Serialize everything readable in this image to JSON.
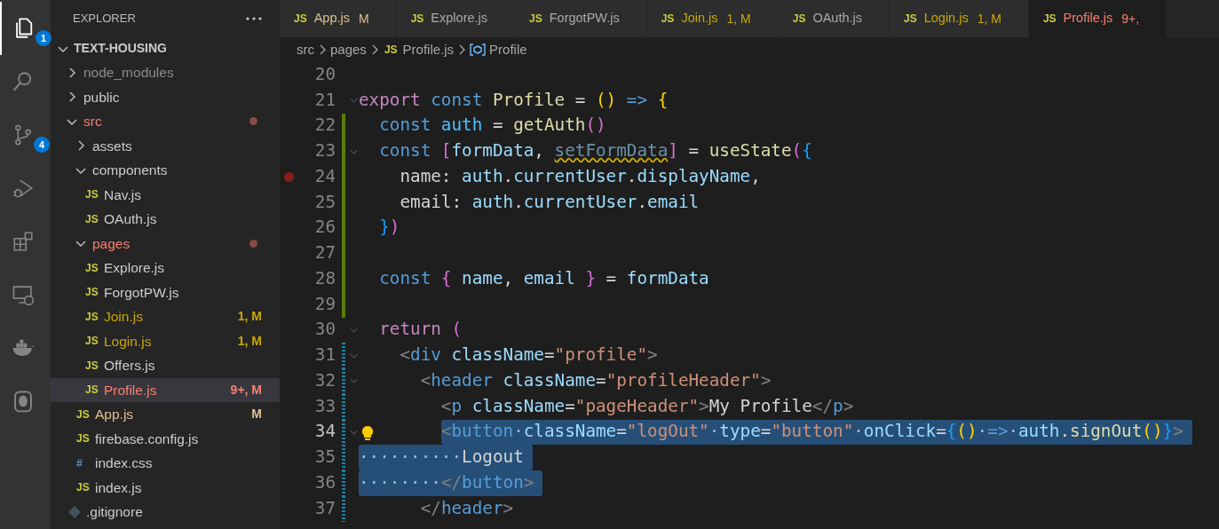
{
  "activity_bar": [
    {
      "kind": "files",
      "selected": true,
      "badge": "1"
    },
    {
      "kind": "search",
      "selected": false
    },
    {
      "kind": "source-control",
      "selected": false,
      "badge": "4"
    },
    {
      "kind": "run-debug",
      "selected": false
    },
    {
      "kind": "extensions",
      "selected": false
    },
    {
      "kind": "remote",
      "selected": false
    },
    {
      "kind": "docker",
      "selected": false
    },
    {
      "kind": "database",
      "selected": false
    }
  ],
  "sidebar": {
    "title": "EXPLORER",
    "root": {
      "label": "TEXT-HOUSING",
      "expanded": true
    },
    "items": [
      {
        "kind": "folder",
        "label": "node_modules",
        "expanded": false,
        "color": "#8c8c8c",
        "dot": false
      },
      {
        "kind": "folder",
        "label": "public",
        "expanded": false,
        "color": "#cccccc",
        "dot": false
      },
      {
        "kind": "folder",
        "label": "src",
        "expanded": true,
        "color": "#f88070",
        "dot": true,
        "children": [
          {
            "kind": "folder",
            "label": "assets",
            "expanded": false,
            "color": "#cccccc",
            "dot": false
          },
          {
            "kind": "folder",
            "label": "components",
            "expanded": true,
            "color": "#cccccc",
            "dot": false,
            "children": [
              {
                "kind": "js",
                "icon_text": "JS",
                "label": "Nav.js",
                "color": "#cccccc",
                "selected": false
              },
              {
                "kind": "js",
                "icon_text": "JS",
                "label": "OAuth.js",
                "color": "#cccccc",
                "selected": false
              }
            ]
          },
          {
            "kind": "folder",
            "label": "pages",
            "expanded": true,
            "color": "#f88070",
            "dot": true,
            "children": [
              {
                "kind": "js",
                "icon_text": "JS",
                "label": "Explore.js",
                "color": "#cccccc",
                "selected": false
              },
              {
                "kind": "js",
                "icon_text": "JS",
                "label": "ForgotPW.js",
                "color": "#cccccc",
                "selected": false
              },
              {
                "kind": "js",
                "icon_text": "JS",
                "label": "Join.js",
                "color": "#cca700",
                "badge": "1, M",
                "selected": false
              },
              {
                "kind": "js",
                "icon_text": "JS",
                "label": "Login.js",
                "color": "#cca700",
                "badge": "1, M",
                "selected": false
              },
              {
                "kind": "js",
                "icon_text": "JS",
                "label": "Offers.js",
                "color": "#cccccc",
                "selected": false
              },
              {
                "kind": "js",
                "icon_text": "JS",
                "label": "Profile.js",
                "color": "#f88070",
                "badge": "9+, M",
                "selected": true
              }
            ]
          },
          {
            "kind": "js",
            "icon_text": "JS",
            "label": "App.js",
            "color": "#e2c08d",
            "badge": "M",
            "selected": false
          },
          {
            "kind": "js",
            "icon_text": "JS",
            "label": "firebase.config.js",
            "color": "#cccccc",
            "selected": false
          },
          {
            "kind": "css",
            "icon_text": "#",
            "label": "index.css",
            "color": "#cccccc",
            "selected": false
          },
          {
            "kind": "js",
            "icon_text": "JS",
            "label": "index.js",
            "color": "#cccccc",
            "selected": false
          }
        ]
      },
      {
        "kind": "git",
        "label": ".gitignore",
        "color": "#cccccc",
        "selected": false
      }
    ]
  },
  "tabs": [
    {
      "icon_text": "JS",
      "label": "App.js",
      "badge": "M",
      "color": "#e2c08d",
      "selected": false
    },
    {
      "icon_text": "JS",
      "label": "Explore.js",
      "color": "#a9a9a9",
      "selected": false
    },
    {
      "icon_text": "JS",
      "label": "ForgotPW.js",
      "color": "#a9a9a9",
      "selected": false
    },
    {
      "icon_text": "JS",
      "label": "Join.js",
      "badge": "1, M",
      "color": "#cca700",
      "selected": false
    },
    {
      "icon_text": "JS",
      "label": "OAuth.js",
      "color": "#a9a9a9",
      "selected": false
    },
    {
      "icon_text": "JS",
      "label": "Login.js",
      "badge": "1, M",
      "color": "#cca700",
      "selected": false
    },
    {
      "icon_text": "JS",
      "label": "Profile.js",
      "badge": "9+,",
      "color": "#f88070",
      "selected": true
    }
  ],
  "breadcrumbs": [
    {
      "kind": "folder",
      "label": "src"
    },
    {
      "kind": "folder",
      "label": "pages"
    },
    {
      "kind": "file",
      "icon_text": "JS",
      "label": "Profile.js"
    },
    {
      "kind": "symbol",
      "label": "Profile"
    }
  ],
  "editor": {
    "lines": [
      {
        "number": "20",
        "added": false,
        "modified": false,
        "fold": false,
        "breakpoint": false,
        "lightbulb": false,
        "current": false,
        "selected": false
      },
      {
        "number": "21",
        "added": false,
        "modified": false,
        "fold": true,
        "breakpoint": false,
        "lightbulb": false,
        "current": false,
        "selected": false,
        "tokens": [
          {
            "kind": "control",
            "text": "export"
          },
          {
            "kind": "keyword",
            "text": " const"
          },
          {
            "kind": "function",
            "text": " Profile"
          },
          {
            "kind": "plain",
            "text": " = "
          },
          {
            "kind": "bracket1",
            "text": "()"
          },
          {
            "kind": "keyword",
            "text": " =>"
          },
          {
            "kind": "bracket1",
            "text": " {"
          }
        ]
      },
      {
        "number": "22",
        "added": true,
        "modified": false,
        "fold": false,
        "breakpoint": false,
        "lightbulb": false,
        "current": false,
        "selected": false,
        "tokens": [
          {
            "kind": "keyword",
            "text": "  const"
          },
          {
            "kind": "constant",
            "text": " auth"
          },
          {
            "kind": "plain",
            "text": " = "
          },
          {
            "kind": "function",
            "text": "getAuth"
          },
          {
            "kind": "bracket2",
            "text": "()"
          }
        ]
      },
      {
        "number": "23",
        "added": true,
        "modified": false,
        "fold": true,
        "breakpoint": false,
        "lightbulb": false,
        "current": false,
        "selected": false,
        "tokens": [
          {
            "kind": "keyword",
            "text": "  const"
          },
          {
            "kind": "bracket2",
            "text": " ["
          },
          {
            "kind": "variable",
            "text": "formData"
          },
          {
            "kind": "plain",
            "text": ", "
          },
          {
            "kind": "unused",
            "text": "setFormData"
          },
          {
            "kind": "bracket2",
            "text": "]"
          },
          {
            "kind": "plain",
            "text": " = "
          },
          {
            "kind": "function",
            "text": "useState"
          },
          {
            "kind": "bracket2",
            "text": "("
          },
          {
            "kind": "bracket3",
            "text": "{"
          }
        ]
      },
      {
        "number": "24",
        "added": true,
        "modified": false,
        "fold": false,
        "breakpoint": true,
        "lightbulb": false,
        "current": false,
        "selected": false,
        "tokens": [
          {
            "kind": "plain",
            "text": "    name: "
          },
          {
            "kind": "variable",
            "text": "auth"
          },
          {
            "kind": "plain",
            "text": "."
          },
          {
            "kind": "variable",
            "text": "currentUser"
          },
          {
            "kind": "plain",
            "text": "."
          },
          {
            "kind": "variable",
            "text": "displayName"
          },
          {
            "kind": "plain",
            "text": ","
          }
        ]
      },
      {
        "number": "25",
        "added": true,
        "modified": false,
        "fold": false,
        "breakpoint": false,
        "lightbulb": false,
        "current": false,
        "selected": false,
        "tokens": [
          {
            "kind": "plain",
            "text": "    email: "
          },
          {
            "kind": "variable",
            "text": "auth"
          },
          {
            "kind": "plain",
            "text": "."
          },
          {
            "kind": "variable",
            "text": "currentUser"
          },
          {
            "kind": "plain",
            "text": "."
          },
          {
            "kind": "variable",
            "text": "email"
          }
        ]
      },
      {
        "number": "26",
        "added": true,
        "modified": false,
        "fold": false,
        "breakpoint": false,
        "lightbulb": false,
        "current": false,
        "selected": false,
        "tokens": [
          {
            "kind": "bracket3",
            "text": "  }"
          },
          {
            "kind": "bracket2",
            "text": ")"
          }
        ]
      },
      {
        "number": "27",
        "added": true,
        "modified": false,
        "fold": false,
        "breakpoint": false,
        "lightbulb": false,
        "current": false,
        "selected": false
      },
      {
        "number": "28",
        "added": true,
        "modified": false,
        "fold": false,
        "breakpoint": false,
        "lightbulb": false,
        "current": false,
        "selected": false,
        "tokens": [
          {
            "kind": "keyword",
            "text": "  const"
          },
          {
            "kind": "bracket2",
            "text": " {"
          },
          {
            "kind": "variable",
            "text": " name"
          },
          {
            "kind": "plain",
            "text": ", "
          },
          {
            "kind": "variable",
            "text": "email"
          },
          {
            "kind": "bracket2",
            "text": " }"
          },
          {
            "kind": "plain",
            "text": " = "
          },
          {
            "kind": "variable",
            "text": "formData"
          }
        ]
      },
      {
        "number": "29",
        "added": true,
        "modified": false,
        "fold": false,
        "breakpoint": false,
        "lightbulb": false,
        "current": false,
        "selected": false
      },
      {
        "number": "30",
        "added": false,
        "modified": false,
        "fold": true,
        "breakpoint": false,
        "lightbulb": false,
        "current": false,
        "selected": false,
        "tokens": [
          {
            "kind": "control",
            "text": "  return"
          },
          {
            "kind": "bracket2",
            "text": " ("
          }
        ]
      },
      {
        "number": "31",
        "added": false,
        "modified": true,
        "fold": true,
        "breakpoint": false,
        "lightbulb": false,
        "current": false,
        "selected": false,
        "tokens": [
          {
            "kind": "tag-bracket",
            "text": "    <"
          },
          {
            "kind": "tag",
            "text": "div"
          },
          {
            "kind": "attribute",
            "text": " className"
          },
          {
            "kind": "plain",
            "text": "="
          },
          {
            "kind": "string",
            "text": "\"profile\""
          },
          {
            "kind": "tag-bracket",
            "text": ">"
          }
        ]
      },
      {
        "number": "32",
        "added": false,
        "modified": true,
        "fold": true,
        "breakpoint": false,
        "lightbulb": false,
        "current": false,
        "selected": false,
        "tokens": [
          {
            "kind": "tag-bracket",
            "text": "      <"
          },
          {
            "kind": "tag",
            "text": "header"
          },
          {
            "kind": "attribute",
            "text": " className"
          },
          {
            "kind": "plain",
            "text": "="
          },
          {
            "kind": "string",
            "text": "\"profileHeader\""
          },
          {
            "kind": "tag-bracket",
            "text": ">"
          }
        ]
      },
      {
        "number": "33",
        "added": false,
        "modified": true,
        "fold": false,
        "breakpoint": false,
        "lightbulb": false,
        "current": false,
        "selected": false,
        "tokens": [
          {
            "kind": "tag-bracket",
            "text": "        <"
          },
          {
            "kind": "tag",
            "text": "p"
          },
          {
            "kind": "attribute",
            "text": " className"
          },
          {
            "kind": "plain",
            "text": "="
          },
          {
            "kind": "string",
            "text": "\"pageHeader\""
          },
          {
            "kind": "tag-bracket",
            "text": ">"
          },
          {
            "kind": "plain",
            "text": "My Profile"
          },
          {
            "kind": "tag-bracket",
            "text": "</"
          },
          {
            "kind": "tag",
            "text": "p"
          },
          {
            "kind": "tag-bracket",
            "text": ">"
          }
        ]
      },
      {
        "number": "34",
        "added": false,
        "modified": true,
        "fold": true,
        "breakpoint": false,
        "lightbulb": true,
        "current": true,
        "selected": true,
        "tokens": [
          {
            "kind": "tag-bracket",
            "text": "        <"
          },
          {
            "kind": "tag",
            "text": "button"
          },
          {
            "kind": "whitespace",
            "text": "·"
          },
          {
            "kind": "attribute",
            "text": "className"
          },
          {
            "kind": "plain",
            "text": "="
          },
          {
            "kind": "string",
            "text": "\"logOut\""
          },
          {
            "kind": "whitespace",
            "text": "·"
          },
          {
            "kind": "attribute",
            "text": "type"
          },
          {
            "kind": "plain",
            "text": "="
          },
          {
            "kind": "string",
            "text": "\"button\""
          },
          {
            "kind": "whitespace",
            "text": "·"
          },
          {
            "kind": "attribute",
            "text": "onClick"
          },
          {
            "kind": "plain",
            "text": "="
          },
          {
            "kind": "bracket3",
            "text": "{"
          },
          {
            "kind": "bracket1",
            "text": "()"
          },
          {
            "kind": "whitespace",
            "text": "·"
          },
          {
            "kind": "keyword",
            "text": "=>"
          },
          {
            "kind": "whitespace",
            "text": "·"
          },
          {
            "kind": "variable",
            "text": "auth"
          },
          {
            "kind": "plain",
            "text": "."
          },
          {
            "kind": "function",
            "text": "signOut"
          },
          {
            "kind": "bracket1",
            "text": "()"
          },
          {
            "kind": "bracket3",
            "text": "}"
          },
          {
            "kind": "tag-bracket",
            "text": ">"
          }
        ]
      },
      {
        "number": "35",
        "added": false,
        "modified": true,
        "fold": false,
        "breakpoint": false,
        "lightbulb": false,
        "current": false,
        "selected": true,
        "tokens": [
          {
            "kind": "whitespace",
            "text": "··········"
          },
          {
            "kind": "plain",
            "text": "Logout"
          }
        ]
      },
      {
        "number": "36",
        "added": false,
        "modified": true,
        "fold": false,
        "breakpoint": false,
        "lightbulb": false,
        "current": false,
        "selected": true,
        "tokens": [
          {
            "kind": "whitespace",
            "text": "········"
          },
          {
            "kind": "tag-bracket",
            "text": "</"
          },
          {
            "kind": "tag",
            "text": "button"
          },
          {
            "kind": "tag-bracket",
            "text": ">"
          }
        ]
      },
      {
        "number": "37",
        "added": false,
        "modified": true,
        "fold": false,
        "breakpoint": false,
        "lightbulb": false,
        "current": false,
        "selected": false,
        "tokens": [
          {
            "kind": "tag-bracket",
            "text": "      </"
          },
          {
            "kind": "tag",
            "text": "header"
          },
          {
            "kind": "tag-bracket",
            "text": ">"
          }
        ]
      }
    ]
  }
}
